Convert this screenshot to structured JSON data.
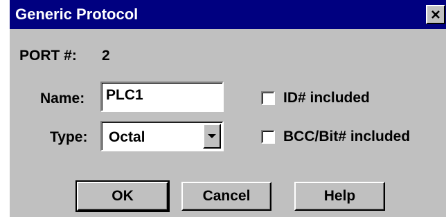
{
  "window": {
    "title": "Generic Protocol",
    "close_icon": "close-icon"
  },
  "port": {
    "label": "PORT #:",
    "value": "2"
  },
  "name_field": {
    "label": "Name:",
    "value": "PLC1"
  },
  "type_field": {
    "label": "Type:",
    "value": "Octal",
    "arrow_icon": "chevron-down-icon"
  },
  "checkboxes": [
    {
      "label": "ID# included",
      "checked": false
    },
    {
      "label": "BCC/Bit# included",
      "checked": false
    }
  ],
  "buttons": {
    "ok": "OK",
    "cancel": "Cancel",
    "help": "Help"
  },
  "colors": {
    "titlebar": "#000080",
    "face": "#c0c0c0"
  }
}
